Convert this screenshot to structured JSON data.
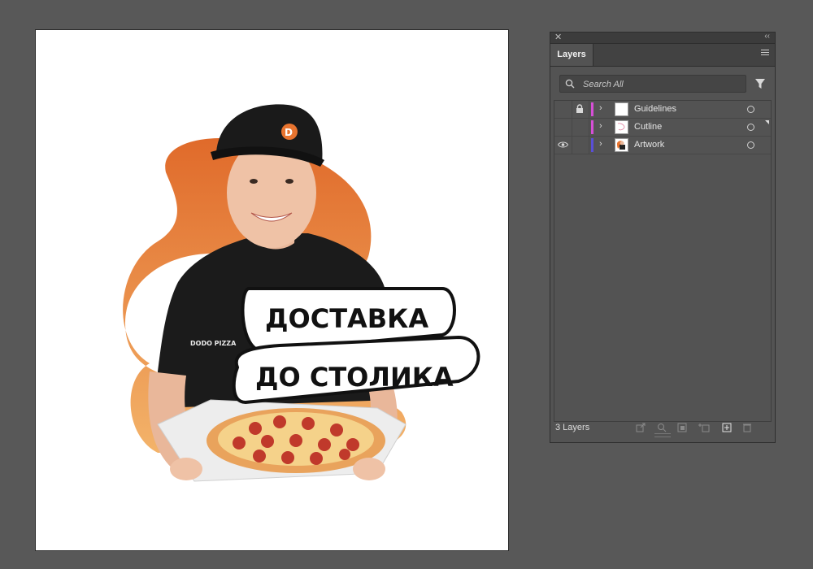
{
  "artwork": {
    "banner_line1": "ДОСТАВКА",
    "banner_line2": "ДО СТОЛИКА",
    "shirt_logo": "DODO PIZZA",
    "colors": {
      "orange": "#e8742f",
      "orange_light": "#f2a35a",
      "shirt": "#1b1b1b"
    }
  },
  "panel": {
    "close_glyph": "✕",
    "collapse_glyph": "‹‹",
    "tab_label": "Layers",
    "search_placeholder": "Search All",
    "layers": [
      {
        "name": "Guidelines",
        "color": "#d64fd6",
        "visible": false,
        "locked": true
      },
      {
        "name": "Cutline",
        "color": "#d64fd6",
        "visible": false,
        "locked": false
      },
      {
        "name": "Artwork",
        "color": "#5a4fd6",
        "visible": true,
        "locked": false
      }
    ],
    "footer": {
      "count": "3 Layers"
    }
  }
}
